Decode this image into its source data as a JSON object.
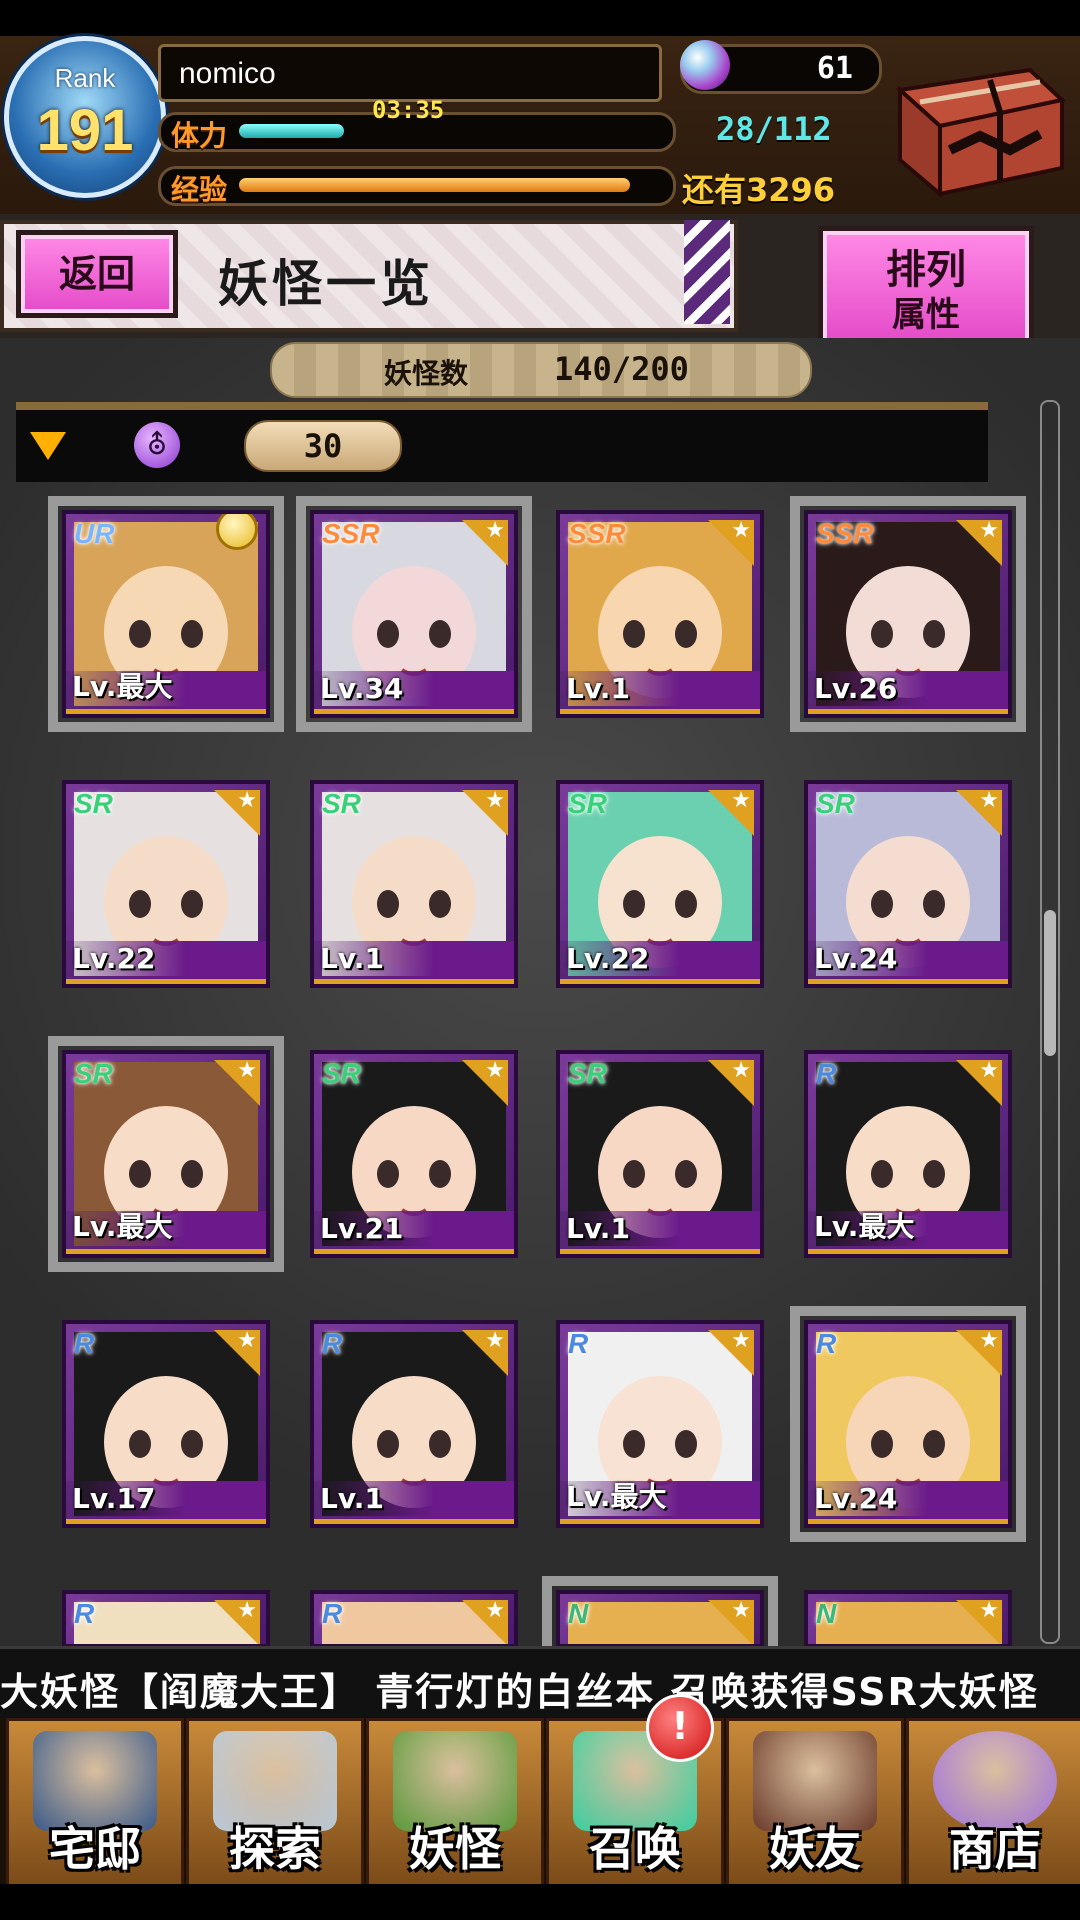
{
  "header": {
    "rank_label": "Rank",
    "rank_value": "191",
    "player_name": "nomico",
    "stamina_label": "体力",
    "stamina_timer": "03:35",
    "stamina_count": "28/112",
    "stamina_fraction": 0.25,
    "exp_label": "经验",
    "exp_remaining": "还有3296",
    "exp_fraction": 0.93,
    "orb_count": "61"
  },
  "title_bar": {
    "back_label": "返回",
    "title": "妖怪一览",
    "sort_line1": "排列",
    "sort_line2": "属性"
  },
  "list": {
    "count_label": "妖怪数",
    "count_value": "140/200",
    "filter_value": "30",
    "filter_icon_glyph": "⛢"
  },
  "cards": [
    {
      "rarity": "UR",
      "level": "Lv.最大",
      "selected": true,
      "crown": true,
      "skin": "#f7d8b4",
      "hair": "#d8a45a"
    },
    {
      "rarity": "SSR",
      "level": "Lv.34",
      "selected": true,
      "skin": "#f2d8d8",
      "hair": "#d8d8e0"
    },
    {
      "rarity": "SSR",
      "level": "Lv.1",
      "selected": false,
      "skin": "#f7d6b0",
      "hair": "#e0a84a"
    },
    {
      "rarity": "SSR",
      "level": "Lv.26",
      "selected": true,
      "skin": "#f3dcd6",
      "hair": "#2a1a1a"
    },
    {
      "rarity": "SR",
      "level": "Lv.22",
      "selected": false,
      "skin": "#f5dcc8",
      "hair": "#e6e0e0"
    },
    {
      "rarity": "SR",
      "level": "Lv.1",
      "selected": false,
      "skin": "#f5dcc8",
      "hair": "#e6e0e0"
    },
    {
      "rarity": "SR",
      "level": "Lv.22",
      "selected": false,
      "skin": "#f7e2d0",
      "hair": "#6ad0b0"
    },
    {
      "rarity": "SR",
      "level": "Lv.24",
      "selected": false,
      "skin": "#f5dcd0",
      "hair": "#b8bad8"
    },
    {
      "rarity": "SR",
      "level": "Lv.最大",
      "selected": true,
      "skin": "#f7dcc8",
      "hair": "#8a5a38"
    },
    {
      "rarity": "SR",
      "level": "Lv.21",
      "selected": false,
      "skin": "#f6d8c4",
      "hair": "#1a1a1a"
    },
    {
      "rarity": "SR",
      "level": "Lv.1",
      "selected": false,
      "skin": "#f6d8c4",
      "hair": "#1a1a1a"
    },
    {
      "rarity": "R",
      "level": "Lv.最大",
      "selected": false,
      "skin": "#f7dcc8",
      "hair": "#1a1a1a"
    },
    {
      "rarity": "R",
      "level": "Lv.17",
      "selected": false,
      "skin": "#f7dcc8",
      "hair": "#1a1a1a"
    },
    {
      "rarity": "R",
      "level": "Lv.1",
      "selected": false,
      "skin": "#f7dcc8",
      "hair": "#1a1a1a"
    },
    {
      "rarity": "R",
      "level": "Lv.最大",
      "selected": false,
      "skin": "#f7e2d4",
      "hair": "#f0f0f0"
    },
    {
      "rarity": "R",
      "level": "Lv.24",
      "selected": true,
      "skin": "#f7d6b8",
      "hair": "#f0c860"
    },
    {
      "rarity": "R",
      "level": "",
      "selected": false,
      "skin": "#f7e2d0",
      "hair": "#f0e0c0"
    },
    {
      "rarity": "R",
      "level": "",
      "selected": false,
      "skin": "#f7e2d0",
      "hair": "#f0c8a0"
    },
    {
      "rarity": "N",
      "level": "",
      "selected": true,
      "skin": "#f7d6b8",
      "hair": "#e6b050"
    },
    {
      "rarity": "N",
      "level": "",
      "selected": false,
      "skin": "#f7d6b8",
      "hair": "#e6b050"
    }
  ],
  "rarity_colors": {
    "UR": "#7ab6ff",
    "SSR": "#ff8a3a",
    "SR": "#3ad07a",
    "R": "#4a8ae0",
    "N": "#3ab87a"
  },
  "ticker": "大妖怪【阎魔大王】   青行灯的白丝本 召唤获得SSR大妖怪",
  "nav": [
    {
      "label": "宅邸",
      "icon": "house-icon",
      "color": "#3a5a8a"
    },
    {
      "label": "探索",
      "icon": "magnifier-icon",
      "color": "#b8c8d8"
    },
    {
      "label": "妖怪",
      "icon": "scroll-icon",
      "color": "#5a9a3a"
    },
    {
      "label": "召唤",
      "icon": "pentagram-icon",
      "color": "#3ad0a0"
    },
    {
      "label": "妖友",
      "icon": "friend-icon",
      "color": "#6a3a2a"
    },
    {
      "label": "商店",
      "icon": "crystal-orb-icon",
      "color": "#a070e0"
    }
  ],
  "summon_badge": "!"
}
